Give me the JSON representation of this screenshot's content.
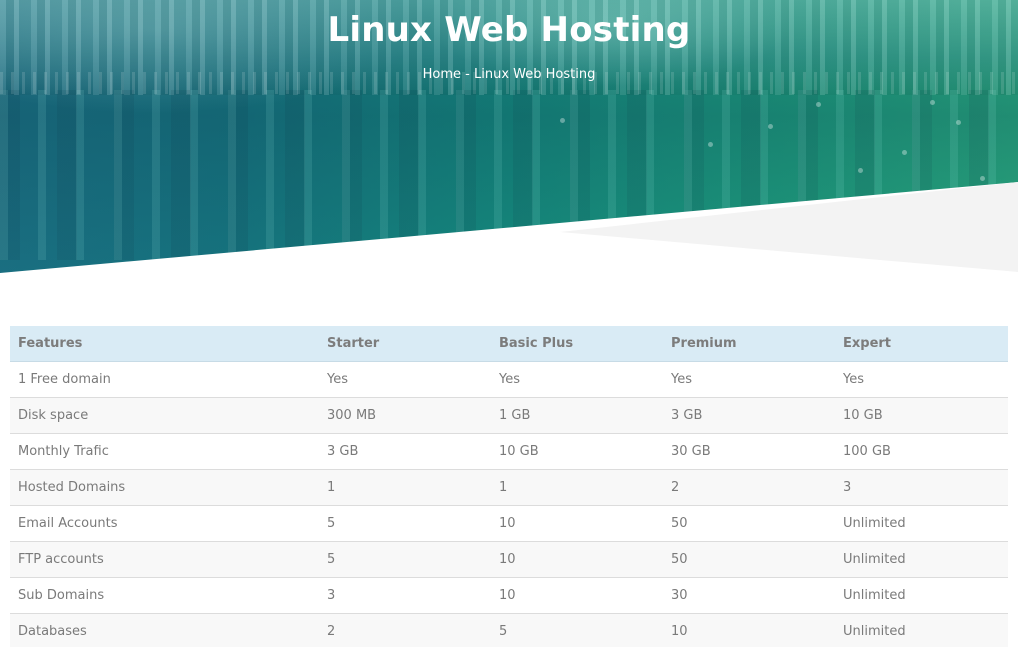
{
  "hero": {
    "title": "Linux Web Hosting",
    "breadcrumb": {
      "home": "Home",
      "separator": " - ",
      "current": "Linux Web Hosting"
    }
  },
  "colors": {
    "hero_teal_left": "#1b6f83",
    "hero_green_right": "#2aaa7e",
    "table_header_bg": "#d9ebf5",
    "table_text": "#7a7a7a"
  },
  "table": {
    "headers": [
      "Features",
      "Starter",
      "Basic Plus",
      "Premium",
      "Expert"
    ],
    "rows": [
      [
        "1 Free domain",
        "Yes",
        "Yes",
        "Yes",
        "Yes"
      ],
      [
        "Disk space",
        "300 MB",
        "1 GB",
        "3 GB",
        "10 GB"
      ],
      [
        "Monthly Trafic",
        "3 GB",
        "10 GB",
        "30 GB",
        "100 GB"
      ],
      [
        "Hosted Domains",
        "1",
        "1",
        "2",
        "3"
      ],
      [
        "Email Accounts",
        "5",
        "10",
        "50",
        "Unlimited"
      ],
      [
        "FTP accounts",
        "5",
        "10",
        "50",
        "Unlimited"
      ],
      [
        "Sub Domains",
        "3",
        "10",
        "30",
        "Unlimited"
      ],
      [
        "Databases",
        "2",
        "5",
        "10",
        "Unlimited"
      ]
    ]
  }
}
